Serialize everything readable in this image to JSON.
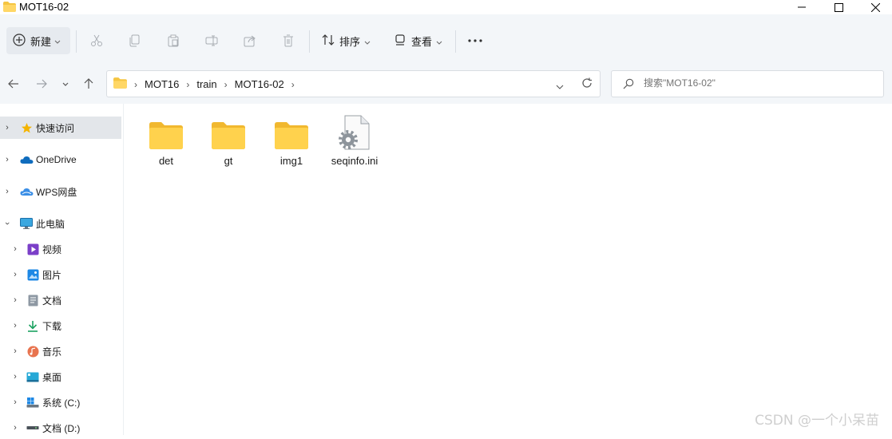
{
  "window": {
    "title": "MOT16-02"
  },
  "toolbar": {
    "new_label": "新建",
    "sort_label": "排序",
    "view_label": "查看"
  },
  "address": {
    "crumbs": [
      "MOT16",
      "train",
      "MOT16-02"
    ]
  },
  "search": {
    "placeholder": "搜索\"MOT16-02\""
  },
  "sidebar": {
    "items": [
      {
        "label": "快速访问",
        "icon": "star-icon"
      },
      {
        "label": "OneDrive",
        "icon": "cloud-icon"
      },
      {
        "label": "WPS网盘",
        "icon": "wps-cloud-icon"
      },
      {
        "label": "此电脑",
        "icon": "monitor-icon"
      },
      {
        "label": "视频",
        "icon": "video-icon"
      },
      {
        "label": "图片",
        "icon": "picture-icon"
      },
      {
        "label": "文档",
        "icon": "document-icon"
      },
      {
        "label": "下载",
        "icon": "download-icon"
      },
      {
        "label": "音乐",
        "icon": "music-icon"
      },
      {
        "label": "桌面",
        "icon": "desktop-icon"
      },
      {
        "label": "系统 (C:)",
        "icon": "drive-c-icon"
      },
      {
        "label": "文档 (D:)",
        "icon": "drive-d-icon"
      }
    ]
  },
  "files": [
    {
      "name": "det",
      "type": "folder"
    },
    {
      "name": "gt",
      "type": "folder"
    },
    {
      "name": "img1",
      "type": "folder"
    },
    {
      "name": "seqinfo.ini",
      "type": "ini"
    }
  ],
  "watermark": "CSDN @一个小呆苗",
  "colors": {
    "folder": "#f5c542",
    "accent": "#0067c0",
    "selected": "#e3e6ea"
  }
}
